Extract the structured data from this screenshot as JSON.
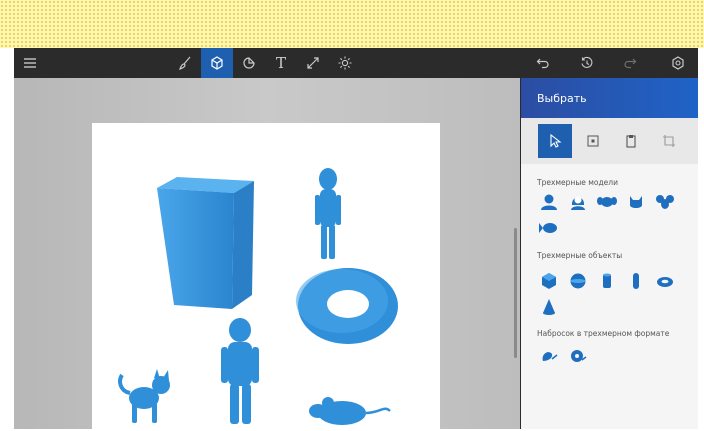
{
  "panel": {
    "title": "Выбрать",
    "sections": {
      "models": "Трехмерные модели",
      "objects": "Трехмерные объекты",
      "sketch": "Набросок в трехмерном формате"
    }
  },
  "toolbar": {
    "text_tool_glyph": "T"
  },
  "colors": {
    "accent": "#1f5fb0",
    "model_blue": "#2f8fd8",
    "toolbar_bg": "#2b2b2b"
  }
}
